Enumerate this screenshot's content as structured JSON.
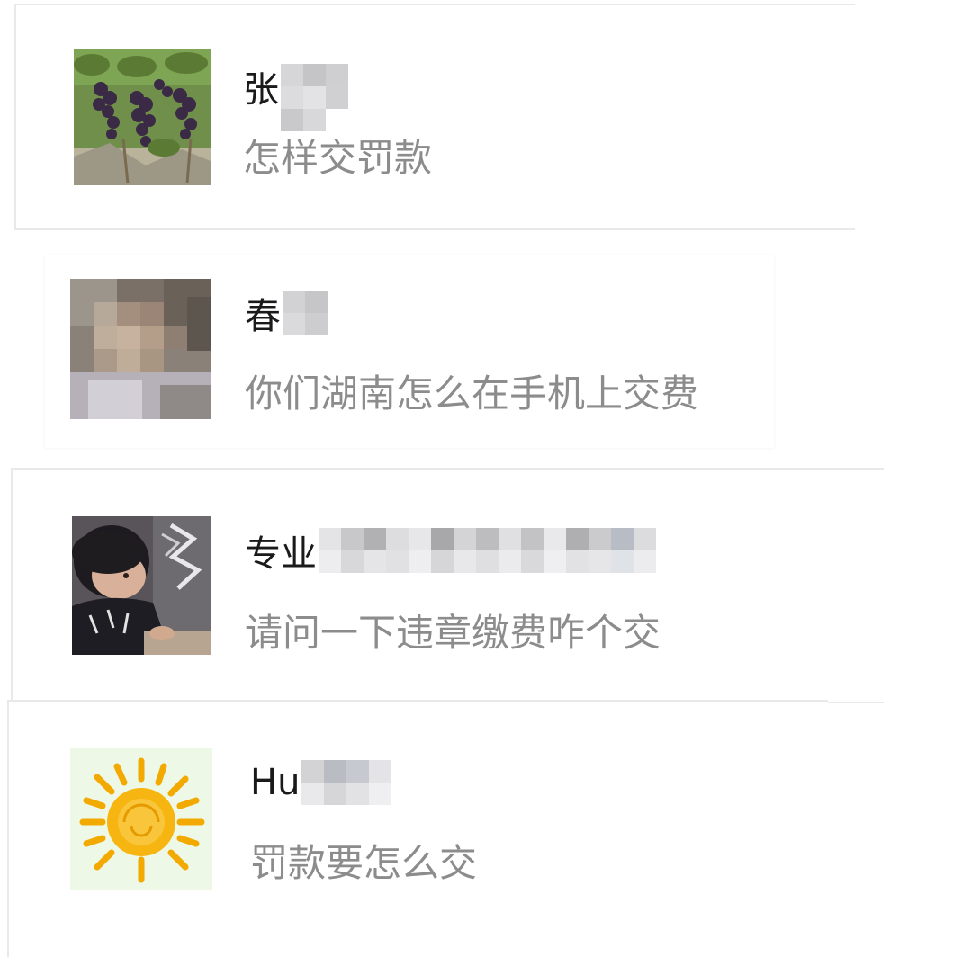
{
  "comments": [
    {
      "name_visible": "张",
      "message": "怎样交罚款",
      "avatar_icon": "grapes-photo-avatar"
    },
    {
      "name_visible": "春",
      "message": "你们湖南怎么在手机上交费",
      "avatar_icon": "blurred-person-avatar"
    },
    {
      "name_visible": "专业",
      "message": "请问一下违章缴费咋个交",
      "avatar_icon": "child-photo-avatar"
    },
    {
      "name_visible": "Hu",
      "message": "罚款要怎么交",
      "avatar_icon": "sun-drawing-avatar"
    }
  ],
  "colors": {
    "name_text": "#1a1a1a",
    "message_text": "#8c8c8c",
    "card_border": "#e9e9e9",
    "background": "#ffffff"
  }
}
